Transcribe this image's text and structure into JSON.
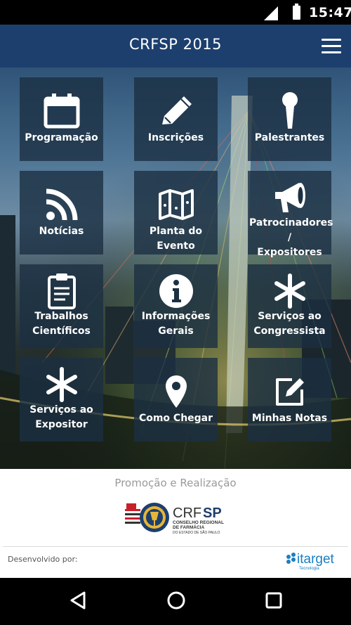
{
  "status_bar": {
    "time": "15:47"
  },
  "app_bar": {
    "title": "CRFSP 2015"
  },
  "tiles": [
    {
      "label": "Programação",
      "icon": "calendar-icon"
    },
    {
      "label": "Inscrições",
      "icon": "pencil-icon"
    },
    {
      "label": "Palestrantes",
      "icon": "microphone-icon"
    },
    {
      "label": "Notícias",
      "icon": "rss-icon"
    },
    {
      "label": "Planta do Evento",
      "icon": "map-icon"
    },
    {
      "label_line1": "Patrocinadores /",
      "label_line2": "Expositores",
      "icon": "megaphone-icon"
    },
    {
      "label_line1": "Trabalhos",
      "label_line2": "Científicos",
      "icon": "clipboard-icon"
    },
    {
      "label_line1": "Informações",
      "label_line2": "Gerais",
      "icon": "info-icon"
    },
    {
      "label_line1": "Serviços ao",
      "label_line2": "Congressista",
      "icon": "asterisk-icon"
    },
    {
      "label_line1": "Serviços ao",
      "label_line2": "Expositor",
      "icon": "asterisk-icon"
    },
    {
      "label": "Como Chegar",
      "icon": "map-pin-icon"
    },
    {
      "label": "Minhas Notas",
      "icon": "edit-note-icon"
    }
  ],
  "footer": {
    "promo_text": "Promoção e Realização",
    "logo": {
      "crf": "CRF",
      "sp": "SP",
      "line1": "CONSELHO REGIONAL",
      "line2": "DE FARMÁCIA",
      "line3": "DO ESTADO DE SÃO PAULO"
    },
    "developed_by": "Desenvolvido por:",
    "developer": {
      "name": "itarget",
      "sub": "Tecnologia"
    }
  },
  "colors": {
    "app_bar": "#1c3f6e",
    "tile_bg": "rgba(28,48,66,0.80)",
    "footer_bg": "#ffffff",
    "itarget_blue": "#1a7fc1"
  }
}
